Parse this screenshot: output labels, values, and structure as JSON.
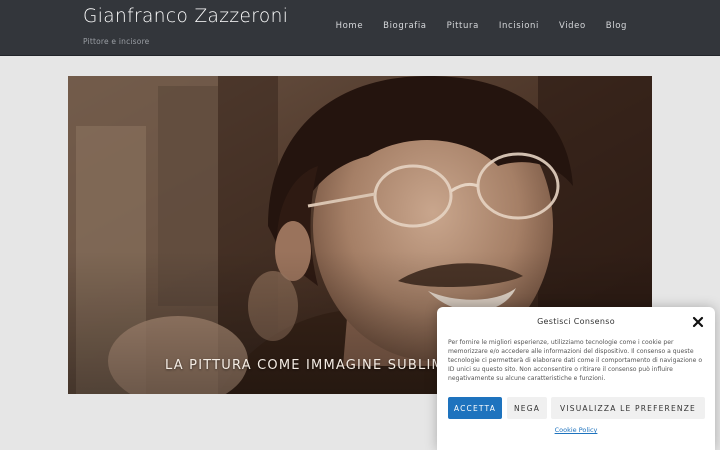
{
  "header": {
    "site_title": "Gianfranco Zazzeroni",
    "tagline": "Pittore e incisore",
    "nav": [
      "Home",
      "Biografia",
      "Pittura",
      "Incisioni",
      "Video",
      "Blog"
    ]
  },
  "hero": {
    "caption": "LA PITTURA COME IMMAGINE SUBLIMATA"
  },
  "consent": {
    "title": "Gestisci Consenso",
    "body": "Per fornire le migliori esperienze, utilizziamo tecnologie come i cookie per memorizzare e/o accedere alle informazioni del dispositivo. Il consenso a queste tecnologie ci permetterà di elaborare dati come il comportamento di navigazione o ID unici su questo sito. Non acconsentire o ritirare il consenso può influire negativamente su alcune caratteristiche e funzioni.",
    "accept_label": "ACCETTA",
    "deny_label": "NEGA",
    "preferences_label": "VISUALIZZA LE PREFERENZE",
    "cookie_policy_label": "Cookie Policy"
  },
  "colors": {
    "header_bg": "#33363b",
    "page_bg": "#e6e6e6",
    "accent": "#1e73be"
  }
}
